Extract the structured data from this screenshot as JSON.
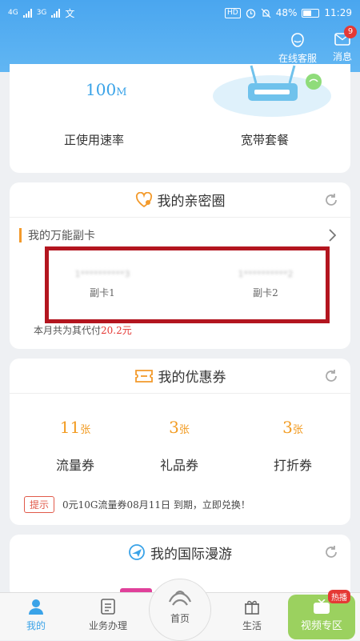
{
  "status_bar": {
    "network_1": "4G",
    "network_2": "3G",
    "carrier_icon": "文",
    "hd": "HD",
    "battery": "48%",
    "time": "11:29"
  },
  "header": {
    "service_label": "在线客服",
    "message_label": "消息",
    "message_badge": "9"
  },
  "speed_card": {
    "speed_value": "100",
    "speed_unit": "M",
    "speed_label": "正使用速率",
    "broadband_label": "宽带套餐"
  },
  "family_card": {
    "title": "我的亲密圈",
    "universal_card_label": "我的万能副卡",
    "sub_cards": [
      {
        "number": "1**********3",
        "label": "副卡1"
      },
      {
        "number": "1**********2",
        "label": "副卡2"
      }
    ],
    "payment_note": "本月共为其代付",
    "payment_amount": "20.2元"
  },
  "coupon_card": {
    "title": "我的优惠券",
    "coupons": [
      {
        "count": "11",
        "unit": "张",
        "name": "流量券"
      },
      {
        "count": "3",
        "unit": "张",
        "name": "礼品券"
      },
      {
        "count": "3",
        "unit": "张",
        "name": "打折券"
      }
    ],
    "tip_label": "提示",
    "tip_text": "0元10G流量券08月11日 到期，立即兑换！"
  },
  "roaming_card": {
    "title": "我的国际漫游"
  },
  "bottom_nav": {
    "items": [
      {
        "label": "我的"
      },
      {
        "label": "业务办理"
      },
      {
        "label": "首页"
      },
      {
        "label": "生活"
      },
      {
        "label": "视频专区"
      }
    ],
    "hot_badge": "热播"
  },
  "colors": {
    "header_blue": "#4aa6ef",
    "accent_orange": "#f29b21",
    "highlight_red": "#b3151f",
    "amount_red": "#e53935"
  }
}
